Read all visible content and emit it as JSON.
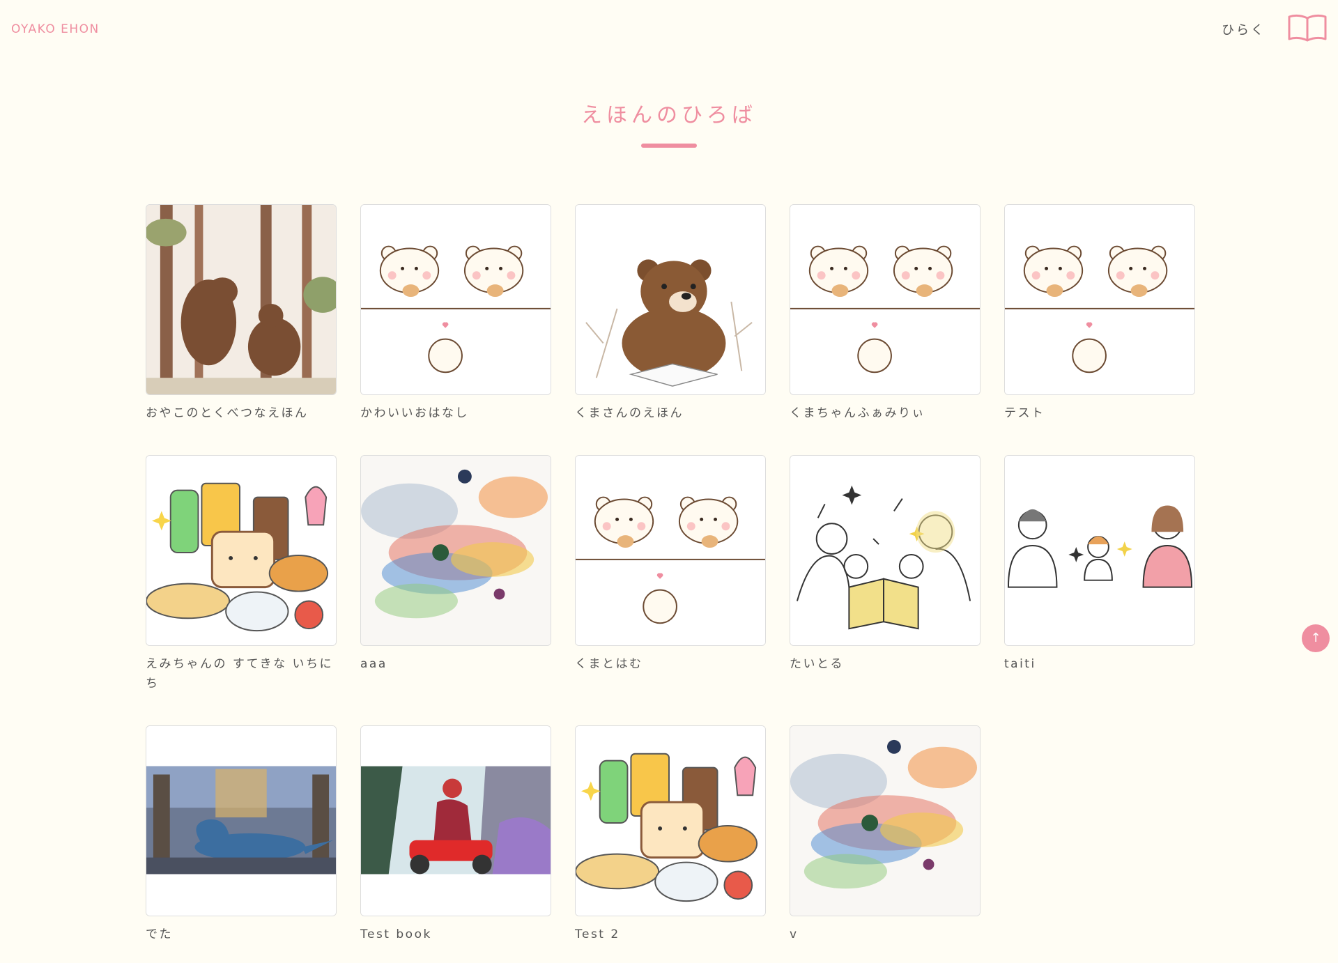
{
  "header": {
    "logo": "OYAKO EHON",
    "open_label": "ひらく",
    "book_icon": "open-book-icon"
  },
  "page": {
    "title": "えほんのひろば"
  },
  "books": [
    {
      "title": "おやこのとくべつなえほん",
      "cover": "forest-bears"
    },
    {
      "title": "かわいいおはなし",
      "cover": "white-bears"
    },
    {
      "title": "くまさんのえほん",
      "cover": "brown-bear-reading"
    },
    {
      "title": "くまちゃんふぁみりぃ",
      "cover": "white-bears"
    },
    {
      "title": "テスト",
      "cover": "white-bears"
    },
    {
      "title": "えみちゃんの すてきな いちにち",
      "cover": "cute-food"
    },
    {
      "title": "aaa",
      "cover": "watercolor-swirl"
    },
    {
      "title": "くまとはむ",
      "cover": "white-bears"
    },
    {
      "title": "たいとる",
      "cover": "family-reading"
    },
    {
      "title": "taiti",
      "cover": "three-people"
    },
    {
      "title": "でた",
      "cover": "dinosaur-palace"
    },
    {
      "title": "Test book",
      "cover": "lizard-motorbike"
    },
    {
      "title": "Test 2",
      "cover": "cute-food"
    },
    {
      "title": "v",
      "cover": "watercolor-swirl"
    }
  ],
  "scroll_top": {
    "icon": "arrow-up-icon",
    "glyph": "↑"
  },
  "colors": {
    "accent": "#ef8ea0",
    "background": "#fffdf4",
    "text": "#555555"
  }
}
